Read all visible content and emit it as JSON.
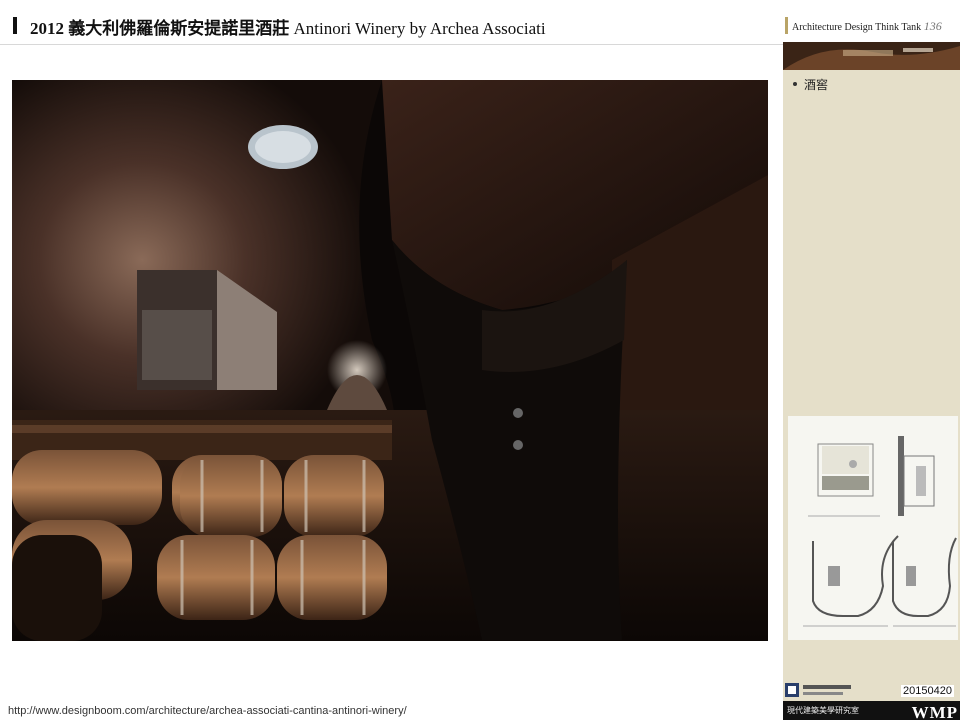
{
  "title": {
    "year": "2012",
    "cjk": "義大利佛羅倫斯安提諾里酒莊",
    "english": "Antinori Winery by Archea Associati"
  },
  "brand": {
    "label": "Architecture Design Think Tank",
    "page_number": "136"
  },
  "sidebar": {
    "bullets": [
      "酒窖"
    ]
  },
  "footer": {
    "date": "20150420",
    "band_text": "現代建築美學研究室",
    "logo_text": "WMP",
    "source_url": "http://www.designboom.com/architecture/archea-associati-cantina-antinori-winery/"
  },
  "colors": {
    "sidebar_bg": "#e5dfc9",
    "accent": "#b9a467",
    "photo_bg": "#0a0706"
  }
}
